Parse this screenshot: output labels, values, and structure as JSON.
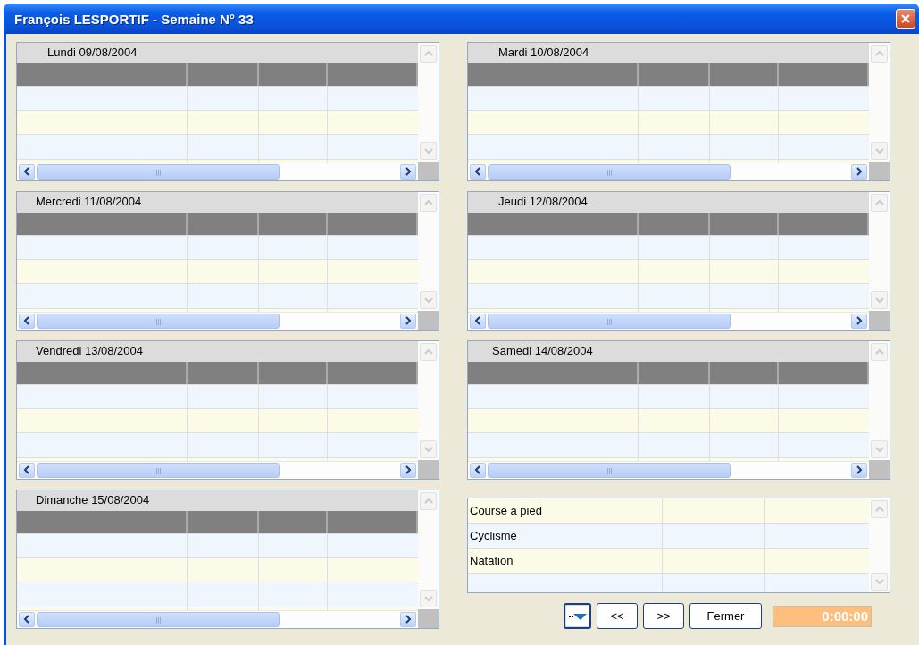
{
  "window": {
    "title": "François LESPORTIF - Semaine N° 33"
  },
  "days": [
    {
      "label": "Lundi 09/08/2004"
    },
    {
      "label": "Mardi 10/08/2004"
    },
    {
      "label": "Mercredi 11/08/2004"
    },
    {
      "label": "Jeudi 12/08/2004"
    },
    {
      "label": "Vendredi 13/08/2004"
    },
    {
      "label": "Samedi 14/08/2004"
    },
    {
      "label": "Dimanche 15/08/2004"
    }
  ],
  "sports": {
    "rows": [
      {
        "label": "Course à pied"
      },
      {
        "label": "Cyclisme"
      },
      {
        "label": "Natation"
      }
    ]
  },
  "buttons": [
    {
      "kind": "filter",
      "selected": true
    },
    {
      "kind": "text",
      "label": "<<"
    },
    {
      "kind": "text",
      "label": ">>"
    },
    {
      "kind": "text",
      "label": "Fermer"
    }
  ],
  "timer": "0:00:00"
}
